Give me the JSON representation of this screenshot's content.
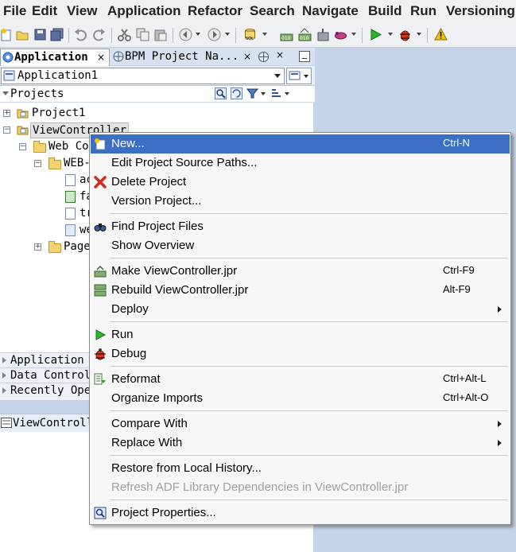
{
  "menubar": {
    "items": [
      {
        "label": "File"
      },
      {
        "label": "Edit"
      },
      {
        "label": "View"
      },
      {
        "label": "Application"
      },
      {
        "label": "Refactor"
      },
      {
        "label": "Search"
      },
      {
        "label": "Navigate"
      },
      {
        "label": "Build"
      },
      {
        "label": "Run"
      },
      {
        "label": "Versioning"
      }
    ]
  },
  "toolbar": {
    "icons": [
      "new-icon",
      "open-icon",
      "save-icon",
      "save-all-icon",
      "undo-icon",
      "redo-icon",
      "cut-icon",
      "copy-icon",
      "paste-icon",
      "back-icon",
      "forward-icon",
      "sql-icon",
      "make-icon",
      "rebuild-icon",
      "clean-icon",
      "run-icon",
      "debug-icon",
      "warning-icon"
    ]
  },
  "navigator": {
    "tabs": [
      {
        "label": "Application"
      },
      {
        "label": "BPM Project Na..."
      }
    ],
    "application_selector": {
      "value": "Application1"
    },
    "projects_label": "Projects",
    "tree": {
      "project1": "Project1",
      "viewcontroller": "ViewController",
      "web_content": "Web Co",
      "web_inf": "WEB-",
      "file1": "ac",
      "file2": "fa",
      "file3": "tr",
      "file4": "we",
      "page_flows": "Page"
    },
    "accordions": [
      {
        "label": "Application R"
      },
      {
        "label": "Data Controls"
      },
      {
        "label": "Recently Open"
      }
    ],
    "structure_label": "ViewControll"
  },
  "context_menu": {
    "groups": [
      [
        {
          "label": "New...",
          "shortcut": "Ctrl-N",
          "icon": "new-icon",
          "selected": true
        },
        {
          "label": "Edit Project Source Paths..."
        },
        {
          "label": "Delete Project",
          "icon": "delete-icon"
        },
        {
          "label": "Version Project..."
        }
      ],
      [
        {
          "label": "Find Project Files",
          "icon": "binoculars-icon"
        },
        {
          "label": "Show Overview"
        }
      ],
      [
        {
          "label": "Make ViewController.jpr",
          "shortcut": "Ctrl-F9",
          "icon": "make-icon"
        },
        {
          "label": "Rebuild ViewController.jpr",
          "shortcut": "Alt-F9",
          "icon": "rebuild-icon"
        },
        {
          "label": "Deploy",
          "submenu": true
        }
      ],
      [
        {
          "label": "Run",
          "icon": "run-icon"
        },
        {
          "label": "Debug",
          "icon": "debug-icon"
        }
      ],
      [
        {
          "label": "Reformat",
          "shortcut": "Ctrl+Alt-L",
          "icon": "reformat-icon"
        },
        {
          "label": "Organize Imports",
          "shortcut": "Ctrl+Alt-O"
        }
      ],
      [
        {
          "label": "Compare With",
          "submenu": true
        },
        {
          "label": "Replace With",
          "submenu": true
        }
      ],
      [
        {
          "label": "Restore from Local History..."
        },
        {
          "label": "Refresh ADF Library Dependencies in ViewController.jpr",
          "disabled": true
        }
      ],
      [
        {
          "label": "Project Properties...",
          "icon": "properties-icon"
        }
      ]
    ]
  },
  "colors": {
    "selection": "#3a6fc4",
    "menubar_bg": "#f0f0f0",
    "panel_bg": "#c6d4ea"
  }
}
